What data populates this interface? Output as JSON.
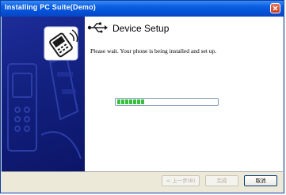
{
  "window": {
    "title": "Installing PC Suite(Demo)",
    "close_icon": "close-icon"
  },
  "header": {
    "icon": "usb-icon",
    "title": "Device Setup"
  },
  "body": {
    "description": "Please wait. Your phone is being installed and set up.",
    "progress_fraction": 0.28
  },
  "buttons": {
    "back": "< 上一步(B)",
    "finish": "完成",
    "cancel": "取消"
  },
  "colors": {
    "titlebar": "#0550d8",
    "side_panel": "#12207e",
    "progress": "#37c23e"
  }
}
